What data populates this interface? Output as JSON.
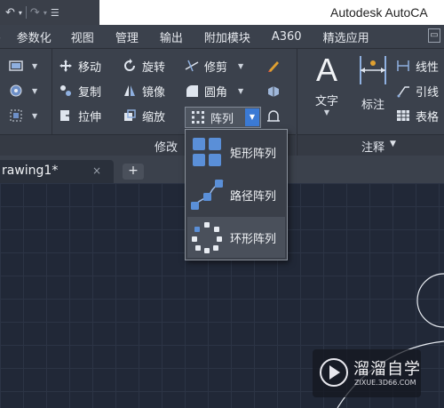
{
  "app": {
    "title": "Autodesk AutoCA"
  },
  "qat": {
    "undo_icon": "undo-arrow-icon",
    "redo_icon": "redo-arrow-icon"
  },
  "menu": {
    "tabs": [
      "参数化",
      "视图",
      "管理",
      "输出",
      "附加模块",
      "A360",
      "精选应用"
    ]
  },
  "ribbon": {
    "modify": {
      "move": "移动",
      "rotate": "旋转",
      "trim": "修剪",
      "copy": "复制",
      "mirror": "镜像",
      "fillet": "圆角",
      "stretch": "拉伸",
      "scale": "缩放",
      "array": "阵列",
      "footer": "修改"
    },
    "annotation": {
      "text": "文字",
      "dimension": "标注",
      "linear": "线性",
      "leader": "引线",
      "table": "表格",
      "footer": "注释"
    }
  },
  "array_menu": {
    "items": [
      "矩形阵列",
      "路径阵列",
      "环形阵列"
    ]
  },
  "doc_tabs": {
    "active": "rawing1*",
    "close": "×",
    "new": "+"
  },
  "watermark": {
    "name": "溜溜自学",
    "url": "ZIXUE.3D66.COM"
  },
  "colors": {
    "accent_blue": "#3b7ad4",
    "ribbon_bg": "#3b414c",
    "canvas_bg": "#212837"
  }
}
